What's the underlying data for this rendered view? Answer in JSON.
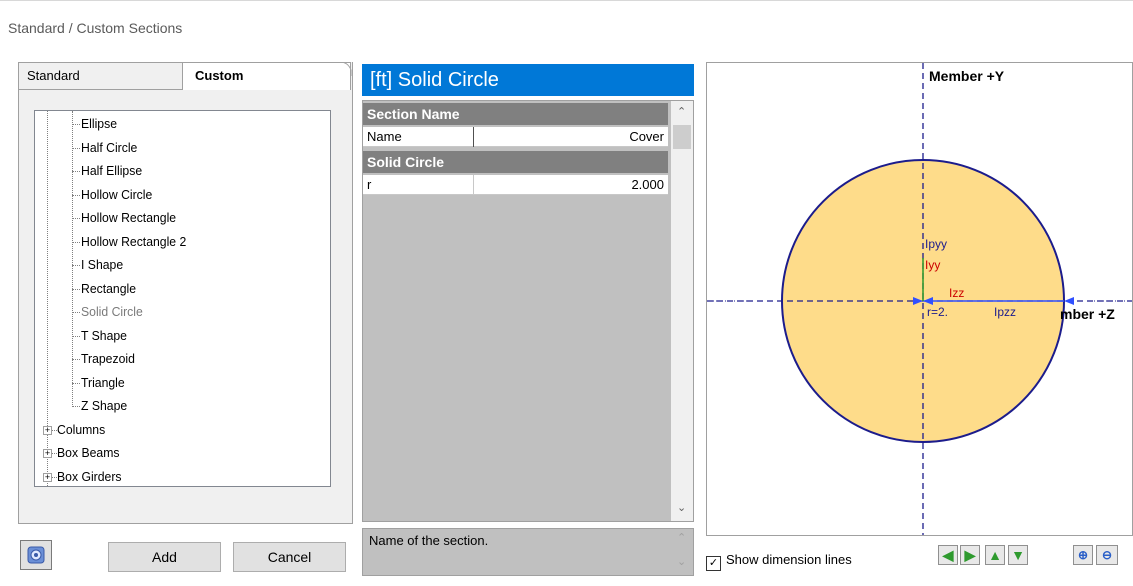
{
  "window": {
    "title": "Standard / Custom Sections"
  },
  "tabs": [
    {
      "label": "Standard",
      "active": false
    },
    {
      "label": "Custom",
      "active": true
    }
  ],
  "tree": {
    "items": [
      {
        "label": "Ellipse",
        "indent": 2
      },
      {
        "label": "Half Circle",
        "indent": 2
      },
      {
        "label": "Half Ellipse",
        "indent": 2
      },
      {
        "label": "Hollow Circle",
        "indent": 2
      },
      {
        "label": "Hollow Rectangle",
        "indent": 2
      },
      {
        "label": "Hollow Rectangle 2",
        "indent": 2
      },
      {
        "label": "I Shape",
        "indent": 2
      },
      {
        "label": "Rectangle",
        "indent": 2
      },
      {
        "label": "Solid Circle",
        "indent": 2,
        "selected": true
      },
      {
        "label": "T Shape",
        "indent": 2
      },
      {
        "label": "Trapezoid",
        "indent": 2
      },
      {
        "label": "Triangle",
        "indent": 2
      },
      {
        "label": "Z Shape",
        "indent": 2
      },
      {
        "label": "Columns",
        "indent": 1,
        "expander": "+"
      },
      {
        "label": "Box Beams",
        "indent": 1,
        "expander": "+"
      },
      {
        "label": "Box Girders",
        "indent": 1,
        "expander": "+"
      }
    ]
  },
  "buttons": {
    "add": "Add",
    "cancel": "Cancel"
  },
  "property_grid": {
    "title": "[ft] Solid Circle",
    "categories": [
      {
        "label": "Section Name",
        "props": [
          {
            "name": "Name",
            "value": "Cover"
          }
        ]
      },
      {
        "label": "Solid Circle",
        "props": [
          {
            "name": "r",
            "value": "2.000"
          }
        ]
      }
    ],
    "description": "Name of the section."
  },
  "preview": {
    "labels": {
      "member_y": "Member +Y",
      "member_z": "mber +Z",
      "ipyy": "Ipyy",
      "iyy": "Iyy",
      "izz": "Izz",
      "ipzz": "Ipzz",
      "r_dim": "r=2."
    },
    "colors": {
      "fill": "#fedc8a",
      "outline": "#1c1c8c",
      "axis": "#1c1c8c",
      "iyy": "#cc0000",
      "izz": "#cc0000"
    },
    "show_dimension_lines_label": "Show dimension lines",
    "show_dimension_lines_checked": true
  },
  "toolbar_icons": [
    "arrow-left-icon",
    "arrow-right-icon",
    "arrow-up-icon",
    "arrow-down-icon",
    "zoom-in-icon",
    "zoom-out-icon"
  ]
}
